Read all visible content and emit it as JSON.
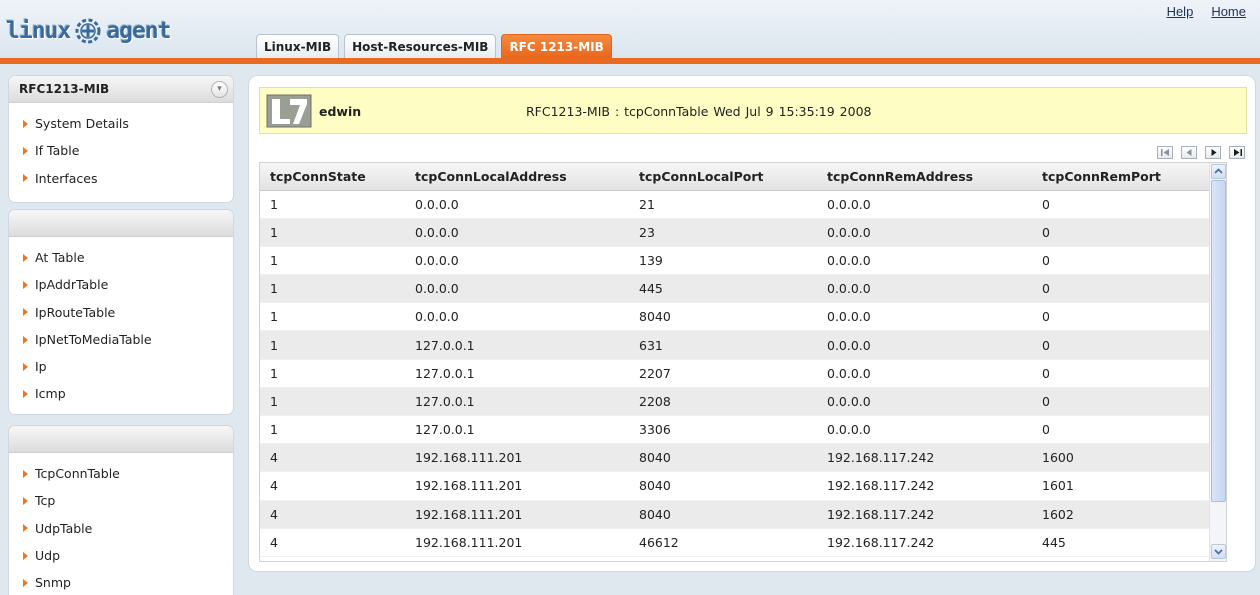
{
  "header": {
    "logo_left": "linux",
    "logo_right": "agent",
    "links": [
      "Help",
      "Home"
    ],
    "tabs": [
      {
        "label": "Linux-MIB",
        "active": false
      },
      {
        "label": "Host-Resources-MIB",
        "active": false
      },
      {
        "label": "RFC 1213-MIB",
        "active": true
      }
    ],
    "accent_color": "#ea6a1f"
  },
  "sidebar": {
    "panel1": {
      "title": "RFC1213-MIB",
      "items": [
        "System Details",
        "If Table",
        "Interfaces"
      ]
    },
    "panel2": {
      "title": "",
      "items": [
        "At Table",
        "IpAddrTable",
        "IpRouteTable",
        "IpNetToMediaTable",
        "Ip",
        "Icmp"
      ]
    },
    "panel3": {
      "title": "",
      "items": [
        "TcpConnTable",
        "Tcp",
        "UdpTable",
        "Udp",
        "Snmp"
      ]
    }
  },
  "banner": {
    "user": "edwin",
    "info": "RFC1213-MIB : tcpConnTable   Wed Jul 9 15:35:19 2008"
  },
  "pager": [
    "first-page-icon",
    "previous-page-icon",
    "next-page-icon",
    "last-page-icon"
  ],
  "table": {
    "columns": [
      "tcpConnState",
      "tcpConnLocalAddress",
      "tcpConnLocalPort",
      "tcpConnRemAddress",
      "tcpConnRemPort"
    ],
    "rows": [
      [
        "1",
        "0.0.0.0",
        "21",
        "0.0.0.0",
        "0"
      ],
      [
        "1",
        "0.0.0.0",
        "23",
        "0.0.0.0",
        "0"
      ],
      [
        "1",
        "0.0.0.0",
        "139",
        "0.0.0.0",
        "0"
      ],
      [
        "1",
        "0.0.0.0",
        "445",
        "0.0.0.0",
        "0"
      ],
      [
        "1",
        "0.0.0.0",
        "8040",
        "0.0.0.0",
        "0"
      ],
      [
        "1",
        "127.0.0.1",
        "631",
        "0.0.0.0",
        "0"
      ],
      [
        "1",
        "127.0.0.1",
        "2207",
        "0.0.0.0",
        "0"
      ],
      [
        "1",
        "127.0.0.1",
        "2208",
        "0.0.0.0",
        "0"
      ],
      [
        "1",
        "127.0.0.1",
        "3306",
        "0.0.0.0",
        "0"
      ],
      [
        "4",
        "192.168.111.201",
        "8040",
        "192.168.117.242",
        "1600"
      ],
      [
        "4",
        "192.168.111.201",
        "8040",
        "192.168.117.242",
        "1601"
      ],
      [
        "4",
        "192.168.111.201",
        "8040",
        "192.168.117.242",
        "1602"
      ],
      [
        "4",
        "192.168.111.201",
        "46612",
        "192.168.117.242",
        "445"
      ]
    ]
  }
}
